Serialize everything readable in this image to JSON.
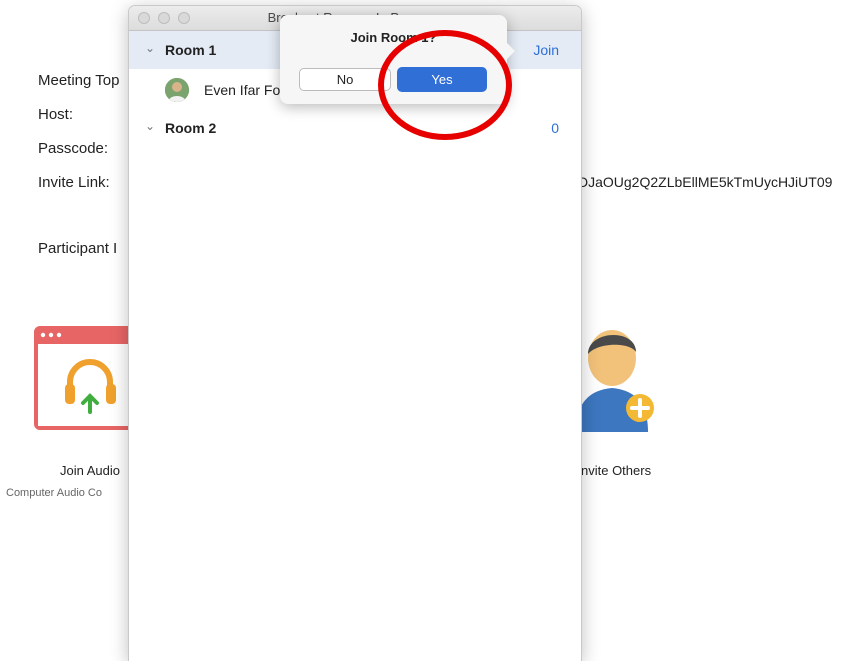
{
  "background": {
    "labels": {
      "meeting_topic": "Meeting Top",
      "host": "Host:",
      "passcode": "Passcode:",
      "invite_link": "Invite Link:",
      "participant_id": "Participant I"
    },
    "invite_link_value": "DJaOUg2Q2ZLbEllME5kTmUycHJiUT09",
    "join_audio": {
      "caption": "Join Audio",
      "sub": "Computer Audio Co"
    },
    "invite_others": {
      "caption": "nvite Others"
    }
  },
  "breakout_window": {
    "title": "Breakout Rooms - In Progress",
    "rooms": [
      {
        "name": "Room 1",
        "action": "Join",
        "participants": [
          "Even Ifar Fo"
        ]
      },
      {
        "name": "Room 2",
        "action": "0",
        "participants": []
      }
    ]
  },
  "confirm_popover": {
    "title": "Join Room 1?",
    "no_label": "No",
    "yes_label": "Yes"
  },
  "colors": {
    "accent": "#2f6fd6",
    "annotation": "#e60000",
    "selected_row": "#e4ebf5"
  }
}
